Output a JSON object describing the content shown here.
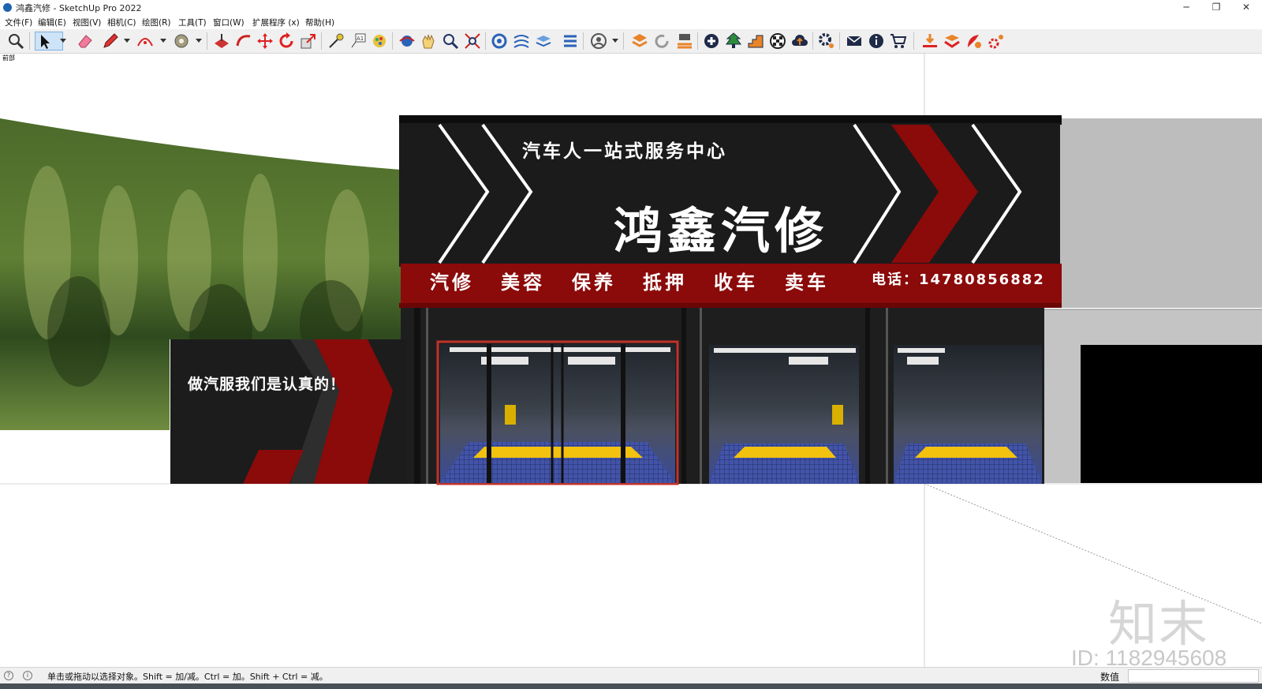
{
  "window": {
    "title": "鸿鑫汽修 - SketchUp Pro 2022",
    "minimize": "─",
    "restore": "❐",
    "close": "✕"
  },
  "menu": [
    "文件(F)",
    "编辑(E)",
    "视图(V)",
    "相机(C)",
    "绘图(R)",
    "工具(T)",
    "窗口(W)",
    "扩展程序 (x)",
    "帮助(H)"
  ],
  "toolbar_icons": [
    "zoom-icon",
    "select-arrow-icon",
    "eraser-icon",
    "pencil-line-icon",
    "arc-icon",
    "paint-bucket-icon",
    "push-pull-icon",
    "follow-me-icon",
    "move-icon",
    "rotate-icon",
    "scale-icon",
    "tape-measure-icon",
    "text-label-icon",
    "paint-icon",
    "orbit-icon",
    "pan-icon",
    "zoom-window-icon",
    "zoom-extents-icon",
    "components-icon",
    "styles-icon",
    "layers-icon",
    "shadows-icon",
    "account-icon",
    "extension-warehouse-icon",
    "refresh-icon",
    "import-icon",
    "add-icon",
    "tree-icon",
    "stairs-icon",
    "checker-icon",
    "cloud-upload-icon",
    "settings-gear-icon",
    "mail-icon",
    "info-icon",
    "cart-icon",
    "download-tray-icon",
    "layers-stack-icon",
    "render-icon",
    "plugins-gear-icon"
  ],
  "scene": {
    "label": "前部",
    "sign": {
      "slogan": "汽车人一站式服务中心",
      "brand": "鸿鑫汽修",
      "services": [
        "汽修",
        "美容",
        "保养",
        "抵押",
        "收车",
        "卖车"
      ],
      "phone": "电话：14780856882"
    },
    "side_panel_text": "做汽服我们是认真的！",
    "colors": {
      "sign_black": "#1a1a1a",
      "sign_red": "#8b0a0a",
      "accent_white": "#ffffff",
      "floor_blue": "#3d4c9a",
      "floor_yellow": "#f2c20f"
    }
  },
  "status": {
    "hint": "单击或拖动以选择对象。Shift = 加/减。Ctrl = 加。Shift + Ctrl = 减。",
    "measure_label": "数值",
    "measure_value": ""
  },
  "watermark": {
    "logo": "知末",
    "id": "ID: 1182945608"
  }
}
